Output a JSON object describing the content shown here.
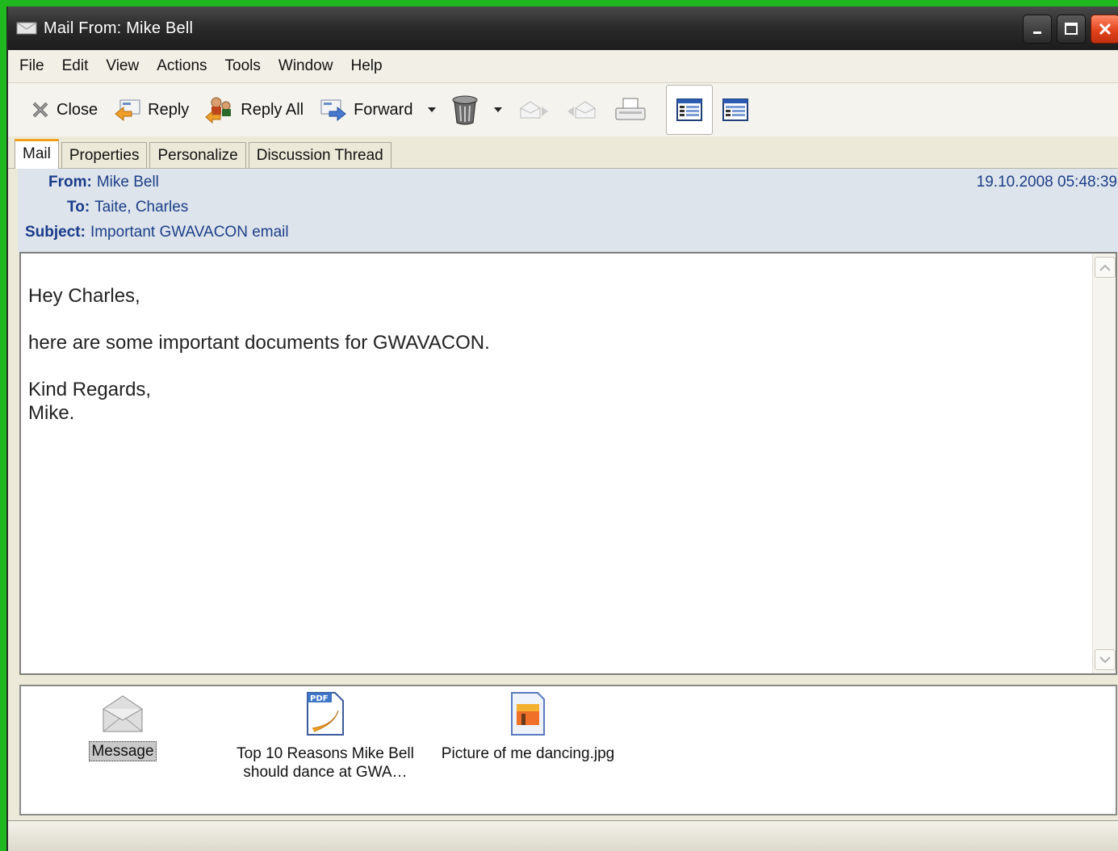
{
  "window": {
    "title": "Mail From: Mike Bell"
  },
  "menu": [
    "File",
    "Edit",
    "View",
    "Actions",
    "Tools",
    "Window",
    "Help"
  ],
  "toolbar": {
    "close_label": "Close",
    "reply_label": "Reply",
    "reply_all_label": "Reply All",
    "forward_label": "Forward"
  },
  "tabs": [
    "Mail",
    "Properties",
    "Personalize",
    "Discussion Thread"
  ],
  "header": {
    "from_label": "From",
    "from_value": "Mike Bell",
    "to_label": "To",
    "to_value": "Taite, Charles",
    "subject_label": "Subject",
    "subject_value": "Important GWAVACON email",
    "date": "19.10.2008 05:48:39"
  },
  "body": {
    "greeting": "Hey Charles,",
    "line1": "here are some important documents for GWAVACON.",
    "closing": "Kind Regards,",
    "signature": "Mike."
  },
  "attachments": [
    {
      "label": "Message",
      "icon": "envelope-icon",
      "selected": true
    },
    {
      "label_line1": "Top 10 Reasons Mike Bell",
      "label_line2": "should dance at GWA…",
      "icon": "pdf-icon"
    },
    {
      "label": "Picture of me dancing.jpg",
      "icon": "image-file-icon"
    }
  ],
  "colors": {
    "desktop": "#1fb81f",
    "header_bg": "#dde4ec",
    "header_text": "#1d3f88",
    "active_tab_accent": "#f2a21e",
    "close_button": "#e3441c"
  }
}
